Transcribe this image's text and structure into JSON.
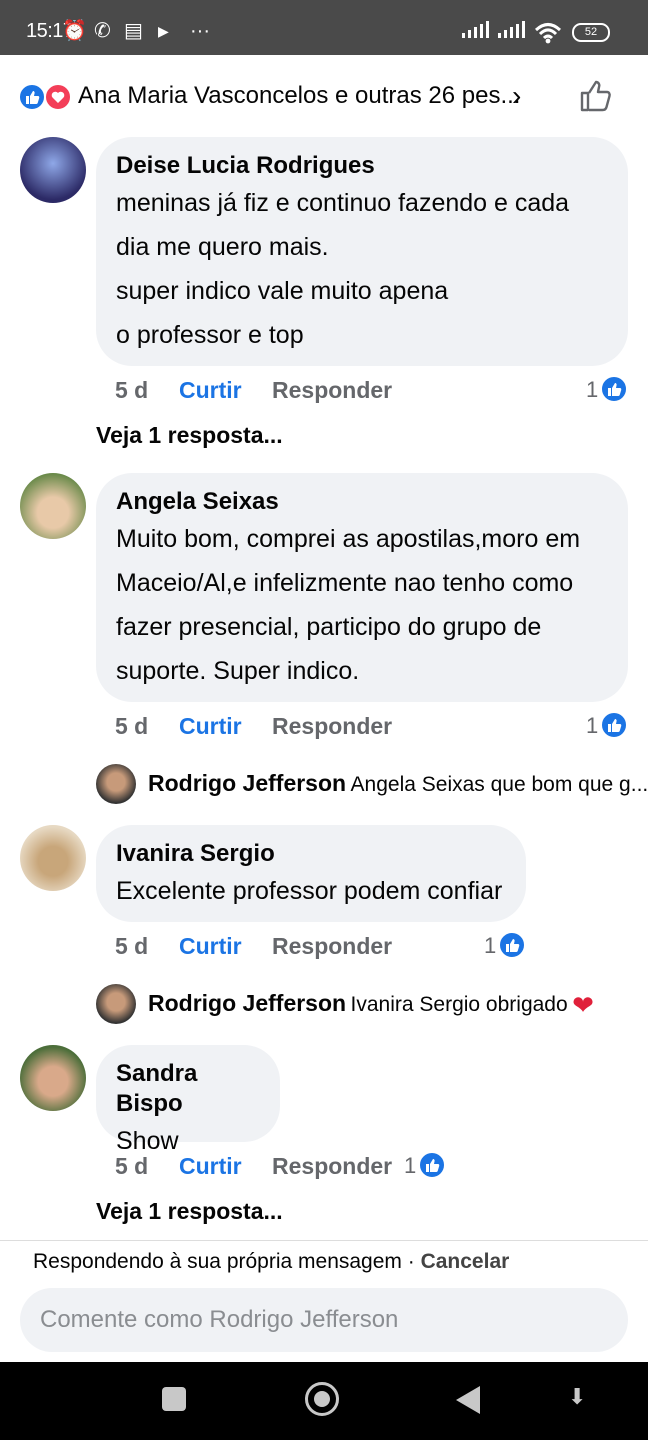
{
  "status_bar": {
    "time": "15:17",
    "battery": "52",
    "icons": [
      "alarm-icon",
      "missed-call-icon",
      "notes-icon",
      "play-icon",
      "more-dots-icon",
      "signal-icon",
      "wifi-icon",
      "battery-icon"
    ]
  },
  "reactions_header": {
    "text": "Ana Maria Vasconcelos e outras 26 pes...",
    "icons": [
      "like-reaction-icon",
      "love-reaction-icon",
      "chevron-right-icon",
      "thumbs-up-outline-icon"
    ]
  },
  "comments": [
    {
      "author": "Deise Lucia Rodrigues",
      "lines": [
        "meninas já fiz e continuo fazendo e cada",
        "dia me quero mais.",
        "super indico vale muito apena",
        "o professor e top"
      ],
      "time": "5 d",
      "like_label": "Curtir",
      "reply_label": "Responder",
      "likes": "1",
      "view_replies": "Veja 1 resposta..."
    },
    {
      "author": "Angela Seixas",
      "lines": [
        "Muito bom, comprei as apostilas,moro em",
        "Maceio/Al,e infelizmente  nao tenho como",
        "fazer presencial, participo do grupo de",
        "suporte. Super indico."
      ],
      "time": "5 d",
      "like_label": "Curtir",
      "reply_label": "Responder",
      "likes": "1",
      "reply": {
        "author": "Rodrigo Jefferson",
        "text": "Angela Seixas  que bom que g..."
      }
    },
    {
      "author": "Ivanira Sergio",
      "lines": [
        "Excelente professor podem confiar"
      ],
      "time": "5 d",
      "like_label": "Curtir",
      "reply_label": "Responder",
      "likes": "1",
      "reply": {
        "author": "Rodrigo Jefferson",
        "text": "Ivanira Sergio obrigado"
      }
    },
    {
      "author": "Sandra Bispo",
      "lines": [
        "Show"
      ],
      "time": "5 d",
      "like_label": "Curtir",
      "reply_label": "Responder",
      "likes": "1",
      "view_replies": "Veja 1 resposta..."
    }
  ],
  "composer": {
    "replying_text": "Respondendo à sua própria mensagem · ",
    "cancel_label": "Cancelar",
    "placeholder": "Comente como Rodrigo Jefferson"
  },
  "colors": {
    "link_blue": "#1b74e4",
    "bubble_gray": "#f0f2f5",
    "love_red": "#f33e58"
  }
}
